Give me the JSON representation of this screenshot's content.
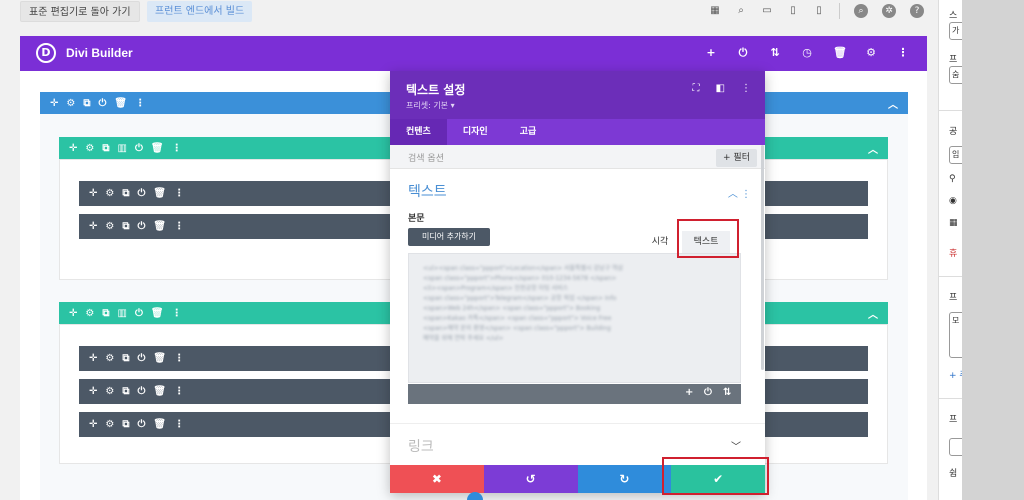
{
  "topbar": {
    "back_button": "표준 편집기로 돌아 가기",
    "frontend_button": "프런트 엔드에서 빌드",
    "icons": [
      "wireframe-icon",
      "zoom-icon",
      "desktop-icon",
      "tablet-icon",
      "phone-icon",
      "search-icon",
      "settings-icon",
      "help-icon"
    ]
  },
  "builder": {
    "logo_letter": "D",
    "title": "Divi Builder",
    "header_icons": [
      "add-icon",
      "power-icon",
      "sort-icon",
      "history-icon",
      "trash-icon",
      "gear-icon",
      "more-icon"
    ],
    "colors": {
      "purple": "#7b2fd6",
      "section_blue": "#3b90d9",
      "row_teal": "#2bc3a4",
      "module_dark": "#4c5866"
    }
  },
  "modal": {
    "title": "텍스트 설정",
    "subtitle": "프리셋: 기본 ▾",
    "tabs": [
      "컨텐츠",
      "디자인",
      "고급"
    ],
    "search_placeholder": "검색 옵션",
    "filter_label": "+ 필터",
    "text_group": "텍스트",
    "body_label": "본문",
    "media_button": "미디어 추가하기",
    "mode_visual": "시각",
    "mode_text": "텍스트",
    "link_group": "링크"
  },
  "wp_sidebar": {
    "labels": [
      "스",
      "가",
      "프",
      "숨",
      "공",
      "임",
      "휴",
      "프",
      "모",
      "+ 주",
      "프",
      "쉼"
    ]
  }
}
